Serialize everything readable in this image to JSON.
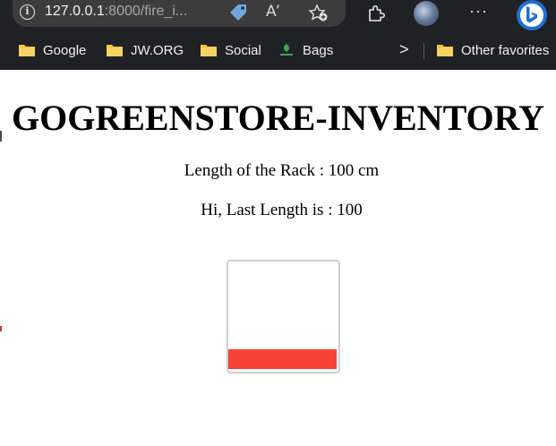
{
  "browser": {
    "url_host": "127.0.0.1",
    "url_path": ":8000/fire_i...",
    "read_aloud_label": "Aʼ",
    "more_label": "···",
    "forward_label": ">",
    "favorites": [
      {
        "label": "Google",
        "icon": "folder-icon"
      },
      {
        "label": "JW.ORG",
        "icon": "folder-icon"
      },
      {
        "label": "Social",
        "icon": "folder-icon"
      },
      {
        "label": "Bags",
        "icon": "gogreen-logo-icon"
      },
      {
        "label": "Other favorites",
        "icon": "folder-icon"
      }
    ]
  },
  "page": {
    "title": "GOGREENSTORE-INVENTORY",
    "rack_length_text": "Length of the Rack : 100 cm",
    "last_length_text": "Hi, Last Length is : 100"
  },
  "gauge": {
    "fill_fraction": 0.2,
    "fill_color": "#f44336",
    "border_color": "#cfcfcf"
  },
  "colors": {
    "chrome_bg": "#202124",
    "address_bg": "#3c3c3c",
    "folder_yellow": "#f4c63f",
    "tag_blue": "#6fa8dc"
  }
}
